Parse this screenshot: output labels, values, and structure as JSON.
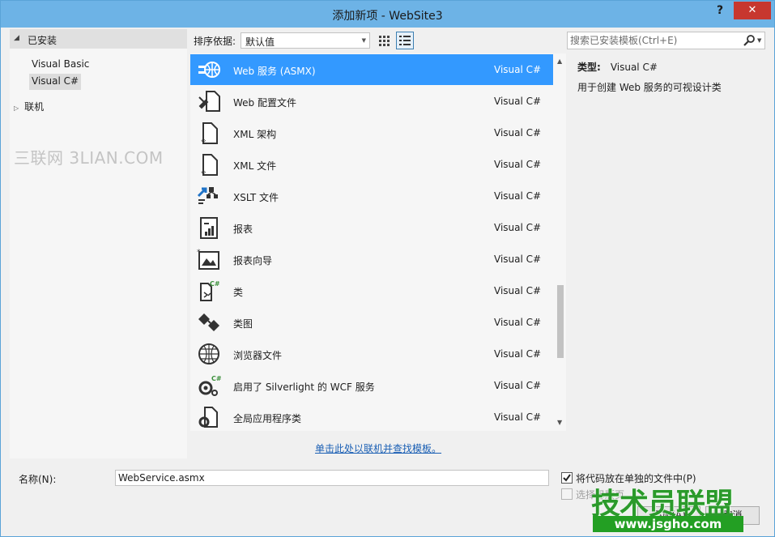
{
  "window": {
    "title": "添加新项 - WebSite3",
    "help_label": "?",
    "close_label": "✕"
  },
  "sidebar": {
    "installed_label": "已安装",
    "items": [
      {
        "label": "Visual Basic",
        "selected": false
      },
      {
        "label": "Visual C#",
        "selected": true
      }
    ],
    "online_label": "联机",
    "watermark": "三联网 3LIAN.COM"
  },
  "toolbar": {
    "sort_label": "排序依据:",
    "sort_value": "默认值",
    "view_modes": [
      "grid-view",
      "list-view"
    ],
    "active_view": "list-view"
  },
  "search": {
    "placeholder": "搜索已安装模板(Ctrl+E)"
  },
  "templates": [
    {
      "name": "Web 服务 (ASMX)",
      "type": "Visual C#",
      "icon": "web-service-icon",
      "selected": true
    },
    {
      "name": "Web 配置文件",
      "type": "Visual C#",
      "icon": "web-config-icon",
      "selected": false
    },
    {
      "name": "XML 架构",
      "type": "Visual C#",
      "icon": "xml-schema-icon",
      "selected": false
    },
    {
      "name": "XML 文件",
      "type": "Visual C#",
      "icon": "xml-file-icon",
      "selected": false
    },
    {
      "name": "XSLT 文件",
      "type": "Visual C#",
      "icon": "xslt-file-icon",
      "selected": false
    },
    {
      "name": "报表",
      "type": "Visual C#",
      "icon": "report-icon",
      "selected": false
    },
    {
      "name": "报表向导",
      "type": "Visual C#",
      "icon": "report-wizard-icon",
      "selected": false
    },
    {
      "name": "类",
      "type": "Visual C#",
      "icon": "class-icon",
      "selected": false
    },
    {
      "name": "类图",
      "type": "Visual C#",
      "icon": "class-diagram-icon",
      "selected": false
    },
    {
      "name": "浏览器文件",
      "type": "Visual C#",
      "icon": "browser-file-icon",
      "selected": false
    },
    {
      "name": "启用了 Silverlight 的 WCF 服务",
      "type": "Visual C#",
      "icon": "silverlight-wcf-icon",
      "selected": false
    },
    {
      "name": "全局应用程序类",
      "type": "Visual C#",
      "icon": "global-app-class-icon",
      "selected": false
    }
  ],
  "details": {
    "type_label": "类型:",
    "type_value": "Visual C#",
    "description": "用于创建 Web 服务的可视设计类"
  },
  "online_link": "单击此处以联机并查找模板。",
  "bottom": {
    "name_label": "名称(N):",
    "name_value": "WebService.asmx",
    "separate_file_label": "将代码放在单独的文件中(P)",
    "separate_file_checked": true,
    "master_page_label": "选择母版页",
    "master_page_checked": false,
    "add_button": "添加(A)",
    "cancel_button": "取消"
  },
  "branding": {
    "name": "技术员联盟",
    "url": "www.jsgho.com"
  },
  "colors": {
    "titlebar": "#6db3e6",
    "selection": "#3399ff",
    "link": "#1a5fb4",
    "brand_green": "#2b9a2b"
  }
}
